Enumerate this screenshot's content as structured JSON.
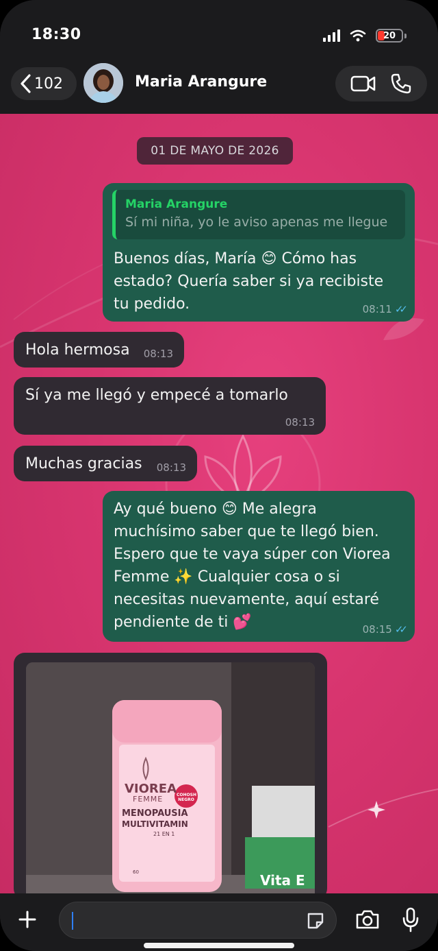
{
  "status_bar": {
    "time": "18:30",
    "battery": "20"
  },
  "header": {
    "back_count": "102",
    "contact_name": "Maria Arangure"
  },
  "chat": {
    "date": "01 DE MAYO DE 2026",
    "messages": [
      {
        "direction": "out",
        "quote": {
          "author": "Maria Arangure",
          "text": "Sí mi niña, yo le aviso apenas me llegue"
        },
        "lines": [
          "Buenos días, María 😊 Cómo has",
          "estado? Quería saber si ya recibiste",
          "tu pedido."
        ],
        "time": "08:11"
      },
      {
        "direction": "in",
        "text": "Hola hermosa",
        "time": "08:13"
      },
      {
        "direction": "in",
        "text": "Sí ya me llegó y empecé a tomarlo",
        "time": "08:13"
      },
      {
        "direction": "in",
        "text": "Muchas gracias",
        "time": "08:13"
      },
      {
        "direction": "out",
        "lines": [
          "Ay qué bueno 😊 Me alegra",
          "muchísimo saber que te llegó bien.",
          "Espero que te vaya súper con Viorea",
          "Femme ✨ Cualquier cosa o si",
          "necesitas nuevamente, aquí estaré",
          "pendiente de ti 💕"
        ],
        "time": "08:15"
      }
    ],
    "photo": {
      "brand": "VIOREA",
      "sub": "FEMME",
      "product_line1": "MENOPAUSIA",
      "product_line2": "MULTIVITAMIN",
      "product_line3": "21 EN 1",
      "badge": "COHOSH NEGRO",
      "count": "60",
      "box_label": "Vita E"
    },
    "watermark": "VIOREA"
  },
  "colors": {
    "chat_bg": "#d8356f",
    "outgoing": "#1f5c4b",
    "incoming": "#302a32",
    "read_ticks": "#53bdeb"
  },
  "icons": [
    "back-chevron-icon",
    "video-call-icon",
    "phone-icon",
    "plus-icon",
    "sticker-icon",
    "camera-icon",
    "microphone-icon"
  ]
}
